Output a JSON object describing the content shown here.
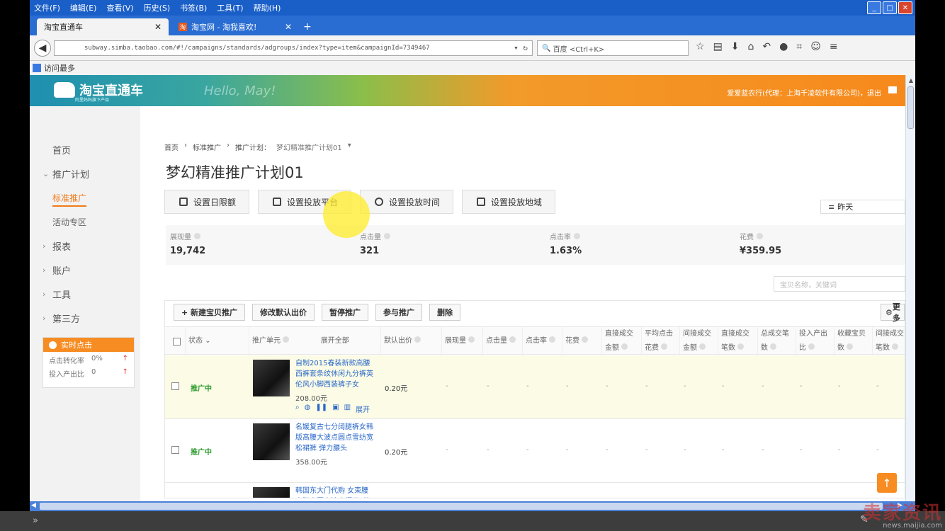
{
  "menu": {
    "items": [
      "文件(F)",
      "编辑(E)",
      "查看(V)",
      "历史(S)",
      "书签(B)",
      "工具(T)",
      "帮助(H)"
    ]
  },
  "tabs": [
    {
      "label": "淘宝直通车"
    },
    {
      "label": "淘宝网 - 淘我喜欢!"
    }
  ],
  "address": {
    "url": "subway.simba.taobao.com/#!/campaigns/standards/adgroups/index?type=item&campaignId=7349467",
    "search_placeholder": "百度 <Ctrl+K>"
  },
  "bookmarks": {
    "item": "访问最多"
  },
  "banner": {
    "logo_text": "淘宝直通车",
    "logo_sub": "阿里妈妈旗下产品",
    "hello": "Hello, May!",
    "user": "爱爱蓝农行(代理：上海千凌软件有限公司)，退出"
  },
  "sidebar": {
    "home": "首页",
    "plans": "推广计划",
    "standard": "标准推广",
    "activity": "活动专区",
    "report": "报表",
    "account": "账户",
    "tools": "工具",
    "third": "第三方",
    "realtime": {
      "title": "实时点击",
      "rows": [
        {
          "label": "点击转化率",
          "value": "0%"
        },
        {
          "label": "投入产出比",
          "value": "0"
        }
      ]
    }
  },
  "breadcrumb": {
    "home": "首页",
    "standard": "标准推广",
    "plan_label": "推广计划：",
    "plan_name": "梦幻精准推广计划01"
  },
  "page_title": "梦幻精准推广计划01",
  "settings": {
    "budget": "设置日限额",
    "platform": "设置投放平台",
    "time": "设置投放时间",
    "region": "设置投放地域",
    "date": "昨天"
  },
  "stats": [
    {
      "label": "展现量",
      "value": "19,742"
    },
    {
      "label": "点击量",
      "value": "321"
    },
    {
      "label": "点击率",
      "value": "1.63%"
    },
    {
      "label": "花费",
      "value": "¥359.95"
    }
  ],
  "search_placeholder": "宝贝名称，关键词",
  "actions": {
    "new": "新建宝贝推广",
    "edit_bid": "修改默认出价",
    "pause": "暂停推广",
    "join": "参与推广",
    "delete": "删除",
    "more": "更多"
  },
  "columns": {
    "status": "状态",
    "unit": "推广单元",
    "expand_all": "展开全部",
    "default_bid": "默认出价",
    "impressions": "展现量",
    "clicks": "点击量",
    "ctr": "点击率",
    "cost": "花费",
    "direct_amt_1": "直接成交",
    "direct_amt_2": "金额",
    "avg_cost_1": "平均点击",
    "avg_cost_2": "花费",
    "indirect_amt_1": "间接成交",
    "indirect_amt_2": "金额",
    "direct_cnt_1": "直接成交",
    "direct_cnt_2": "笔数",
    "total_cnt_1": "总成交笔",
    "total_cnt_2": "数",
    "roi_1": "投入产出",
    "roi_2": "比",
    "fav_1": "收藏宝贝",
    "fav_2": "数",
    "indirect_cnt_1": "间接成交",
    "indirect_cnt_2": "笔数"
  },
  "rows": [
    {
      "status": "推广中",
      "title": "自制2015春装新款高腰西裤套条纹休闲九分裤英伦风小脚西装裤子女",
      "price": "208.00元",
      "bid": "0.20元",
      "expand": "展开",
      "dash": "-"
    },
    {
      "status": "推广中",
      "title": "名媛复古七分阔腿裤女韩版高腰大波点圆点雪纺宽松裙裤 弹力腰头",
      "price": "358.00元",
      "bid": "0.20元",
      "dash": "-"
    },
    {
      "title": "韩国东大门代购 女束腰高腰大圆点波点摆尾 喇"
    }
  ],
  "watermark": {
    "brand": "卖家资讯",
    "site": "news.maijia.com"
  }
}
